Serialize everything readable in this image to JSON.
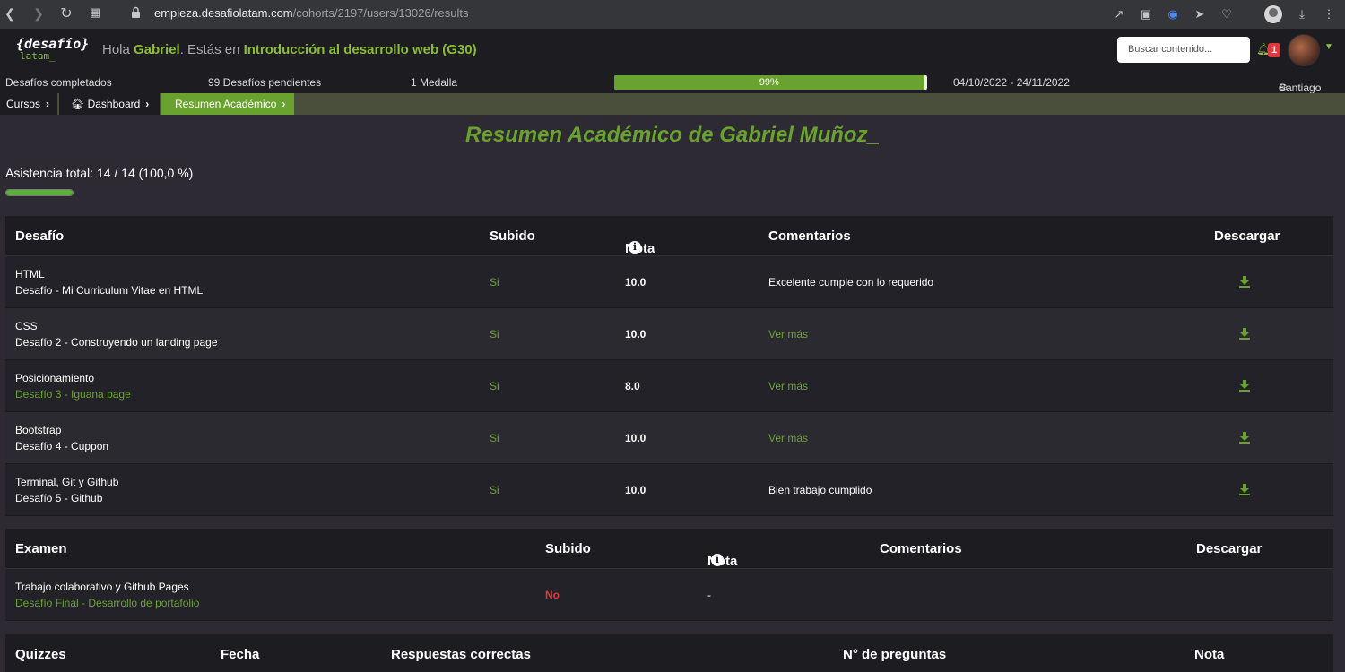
{
  "browser": {
    "url_host": "empieza.desafiolatam.com",
    "url_path": "/cohorts/2197/users/13026/results"
  },
  "header": {
    "logo_top": "{desafío}",
    "logo_bottom": "latam_",
    "greet_prefix": "Hola ",
    "user_name": "Gabriel",
    "greet_mid": ". Estás en ",
    "course": "Introducción al desarrollo web (G30)",
    "search_placeholder": "Buscar contenido...",
    "notifications": "1"
  },
  "stats": {
    "completed": "Desafíos completados",
    "pending": "99 Desafíos pendientes",
    "medals": "1 Medalla",
    "progress_label": "99%",
    "progress_value": 99,
    "dates": "04/10/2022 - 24/11/2022",
    "city": "Santiago"
  },
  "breadcrumb": {
    "items": [
      "Cursos",
      "Dashboard",
      "Resumen Académico"
    ]
  },
  "page": {
    "title": "Resumen Académico de Gabriel Muñoz_",
    "attendance": "Asistencia total: 14 / 14 (100,0 %)",
    "attendance_value": 100
  },
  "challenges": {
    "headers": [
      "Desafío",
      "Subido",
      "Nota",
      "Comentarios",
      "Descargar"
    ],
    "rows": [
      {
        "topic": "HTML",
        "name": "Desafío - Mi Curriculum Vitae en HTML",
        "uploaded": "Si",
        "grade": "10.0",
        "comment": "Excelente cumple con lo requerido"
      },
      {
        "topic": "CSS",
        "name": "Desafío 2 - Construyendo un landing page",
        "uploaded": "Si",
        "grade": "10.0",
        "comment": "Ver más"
      },
      {
        "topic": "Posicionamiento",
        "name": "Desafío 3 - Iguana page",
        "uploaded": "Si",
        "grade": "8.0",
        "comment": "Ver más"
      },
      {
        "topic": "Bootstrap",
        "name": "Desafío 4 - Cuppon",
        "uploaded": "Si",
        "grade": "10.0",
        "comment": "Ver más"
      },
      {
        "topic": "Terminal, Git y Github",
        "name": "Desafío 5 - Github",
        "uploaded": "Si",
        "grade": "10.0",
        "comment": "Bien trabajo cumplido"
      }
    ]
  },
  "exam": {
    "headers": [
      "Examen",
      "Subido",
      "Nota",
      "Comentarios",
      "Descargar"
    ],
    "row": {
      "topic": "Trabajo colaborativo y Github Pages",
      "name": "Desafío Final - Desarrollo de portafolio",
      "uploaded": "No",
      "grade": "-"
    }
  },
  "quizzes": {
    "headers": [
      "Quizzes",
      "Fecha",
      "Respuestas correctas",
      "N° de preguntas",
      "Nota"
    ]
  },
  "colors": {
    "accent": "#6aa22f",
    "danger": "#e0393e",
    "background": "#2d2a33"
  }
}
